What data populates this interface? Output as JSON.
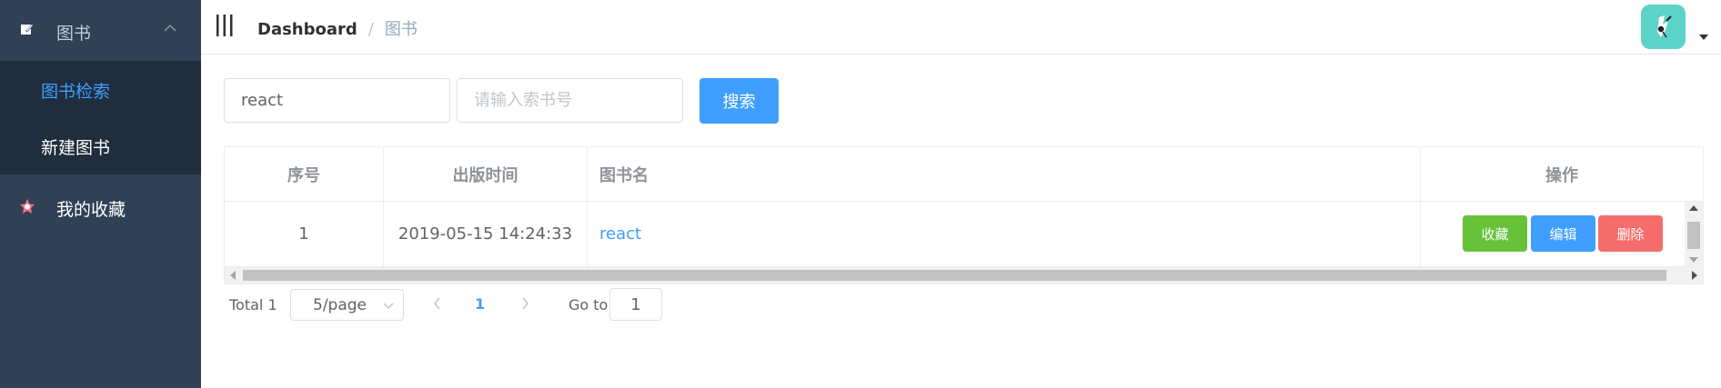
{
  "sidebar": {
    "parent": {
      "label": "图书",
      "icon": "edit-icon",
      "expanded": true
    },
    "items": [
      {
        "label": "图书检索",
        "active": true
      },
      {
        "label": "新建图书",
        "active": false
      }
    ],
    "favorites": {
      "label": "我的收藏",
      "icon": "star-icon"
    },
    "colors": {
      "bg": "#304156",
      "submenu_bg": "#1f2d3d",
      "active": "#409eff"
    }
  },
  "navbar": {
    "breadcrumb": [
      "Dashboard",
      "图书"
    ],
    "separator": "/"
  },
  "filter": {
    "title_value": "react",
    "call_number_placeholder": "请输入索书号",
    "search_label": "搜索"
  },
  "table": {
    "columns": [
      "序号",
      "出版时间",
      "图书名",
      "操作"
    ],
    "rows": [
      {
        "index": "1",
        "published": "2019-05-15 14:24:33",
        "name": "react"
      }
    ],
    "actions": {
      "favorite": "收藏",
      "edit": "编辑",
      "delete": "删除"
    }
  },
  "pagination": {
    "total_text": "Total 1",
    "page_size": "5/page",
    "current_page": "1",
    "goto_label": "Go to",
    "goto_value": "1"
  }
}
